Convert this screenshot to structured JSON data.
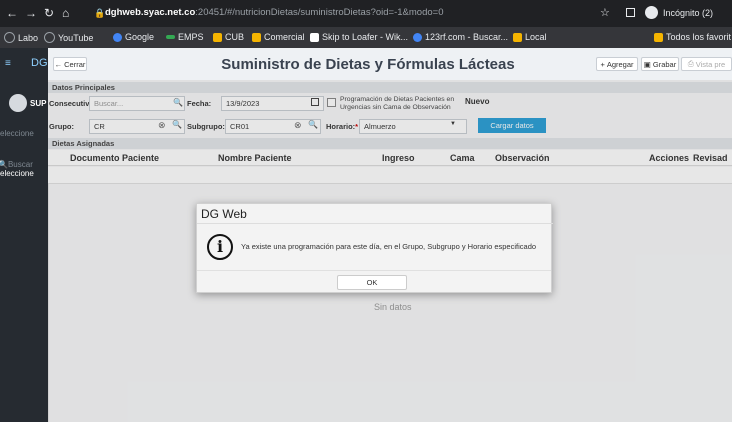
{
  "browser": {
    "url_host": "dghweb.syac.net.co",
    "url_rest": ":20451/#/nutricionDietas/suministroDietas?oid=-1&modo=0",
    "incognito_label": "Incógnito (2)",
    "bookmarks": [
      {
        "label": "Labo",
        "color": "#9aa0a6"
      },
      {
        "label": "YouTube",
        "color": "#9aa0a6"
      },
      {
        "label": "Google",
        "color": "#4285f4"
      },
      {
        "label": "EMPS",
        "color": "#34a853"
      },
      {
        "label": "CUB",
        "color": "#f5b400"
      },
      {
        "label": "Comercial",
        "color": "#f5b400"
      },
      {
        "label": "Skip to Loafer - Wik...",
        "color": "#ffffff"
      },
      {
        "label": "123rf.com - Buscar...",
        "color": "#4285f4"
      },
      {
        "label": "Local",
        "color": "#f5b400"
      }
    ],
    "all_bookmarks": "Todos los favorit"
  },
  "sidebar": {
    "app_code": "DG",
    "user_label": "SUP",
    "select_label": "eleccione",
    "search_label": "Buscar",
    "select2_label": "eleccione"
  },
  "header": {
    "back_label": "Cerrar",
    "title": "Suministro de Dietas y Fórmulas Lácteas",
    "add_label": "Agregar",
    "save_label": "Grabar",
    "preview_label": "Vista pre"
  },
  "form": {
    "section_main": "Datos Principales",
    "consecutivo_label": "Consecutivo:",
    "consecutivo_placeholder": "Buscar...",
    "fecha_label": "Fecha:",
    "fecha_value": "13/9/2023",
    "programacion_label": "Programación de Dietas Pacientes en Urgencias sin Cama de Observación",
    "status": "Nuevo",
    "grupo_label": "Grupo:",
    "grupo_value": "CR",
    "subgrupo_label": "Subgrupo:",
    "subgrupo_value": "CR01",
    "horario_label": "Horario:",
    "horario_value": "Almuerzo",
    "load_button": "Cargar datos",
    "section_assigned": "Dietas Asignadas"
  },
  "table": {
    "columns": [
      "Documento Paciente",
      "Nombre Paciente",
      "Ingreso",
      "Cama",
      "Observación",
      "Acciones",
      "Revisad"
    ],
    "empty_text": "Sin datos"
  },
  "dialog": {
    "title": "DG Web",
    "message": "Ya existe una programación para este día, en el Grupo, Subgrupo y Horario especificado",
    "ok_label": "OK"
  },
  "colors": {
    "accent": "#2a9fd6",
    "sidebar": "#262b31"
  }
}
